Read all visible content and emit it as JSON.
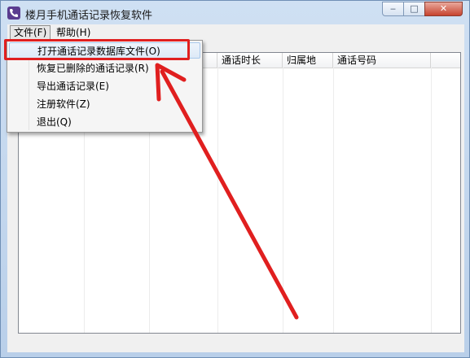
{
  "window": {
    "title": "楼月手机通话记录恢复软件",
    "controls": {
      "minimize": "‒",
      "maximize": "□",
      "close": "✕"
    }
  },
  "menubar": {
    "file": "文件(F)",
    "help": "帮助(H)"
  },
  "file_menu": {
    "items": [
      {
        "label": "打开通话记录数据库文件(O)"
      },
      {
        "label": "恢复已删除的通话记录(R)"
      },
      {
        "label": "导出通话记录(E)"
      },
      {
        "label": "注册软件(Z)"
      },
      {
        "label": "退出(Q)"
      }
    ]
  },
  "table": {
    "columns": [
      "通话时长",
      "归属地",
      "通话号码"
    ]
  },
  "colors": {
    "annotation_red": "#e01f1f"
  },
  "icons": {
    "app": "phone-icon",
    "annotation": "red-arrow-annotation"
  }
}
